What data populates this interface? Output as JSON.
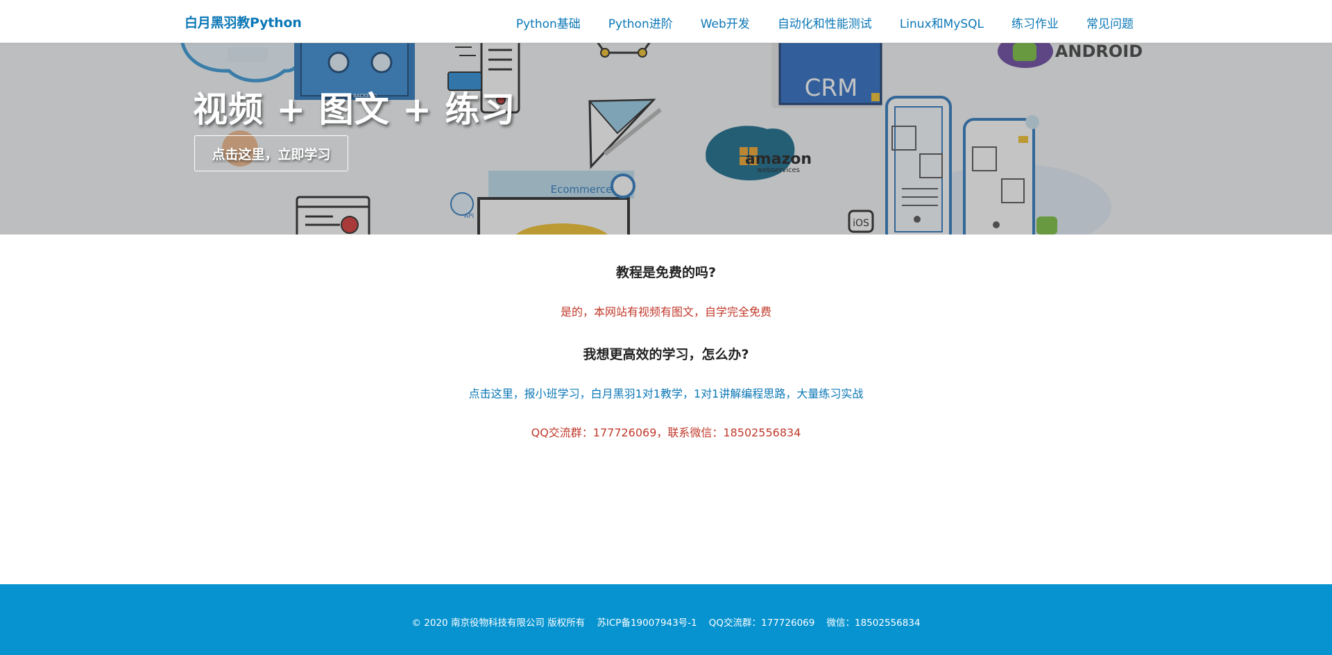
{
  "header": {
    "brand": "白月黑羽教Python",
    "nav": [
      {
        "label": "Python基础"
      },
      {
        "label": "Python进阶"
      },
      {
        "label": "Web开发"
      },
      {
        "label": "自动化和性能测试"
      },
      {
        "label": "Linux和MySQL"
      },
      {
        "label": "练习作业"
      },
      {
        "label": "常见问题"
      }
    ]
  },
  "hero": {
    "title": "视频 + 图文 + 练习",
    "cta_label": "点击这里，立即学习",
    "illustration_texts": {
      "crm": "CRM",
      "android": "ANDROID",
      "amazon": "amazon",
      "aws": "webservices",
      "ios": "iOS",
      "ecommerce": "Ecommerce",
      "api": "API",
      "backend": "BACKEND"
    }
  },
  "faq": {
    "q1": "教程是免费的吗?",
    "a1": "是的，本网站有视频有图文，自学完全免费",
    "q2": "我想更高效的学习，怎么办?",
    "a2_link": "点击这里，报小班学习，白月黑羽1对1教学，1对1讲解编程思路，大量练习实战",
    "a3": "QQ交流群：177726069，联系微信：18502556834"
  },
  "footer": {
    "text": "© 2020 南京役物科技有限公司 版权所有    苏ICP备19007943号-1    QQ交流群：177726069    微信：18502556834"
  },
  "colors": {
    "brand_blue": "#0b77b6",
    "footer_blue": "#0693d0",
    "answer_red": "#c0392b"
  }
}
